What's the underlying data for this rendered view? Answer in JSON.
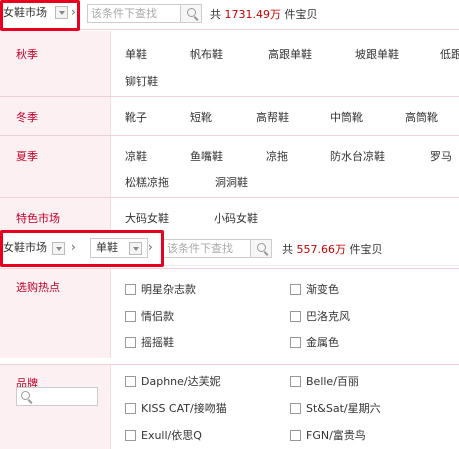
{
  "top_bar": {
    "market_label": "女鞋市场",
    "search_placeholder": "该条件下查找",
    "count_prefix": "共",
    "count_value": "1731.49万",
    "count_suffix": "件宝贝"
  },
  "categories": [
    {
      "label": "秋季",
      "items": [
        "单鞋",
        "帆布鞋",
        "高跟单鞋",
        "坡跟单鞋",
        "低跟",
        "铆钉鞋"
      ]
    },
    {
      "label": "冬季",
      "items": [
        "靴子",
        "短靴",
        "高帮鞋",
        "中筒靴",
        "高筒靴"
      ]
    },
    {
      "label": "夏季",
      "items": [
        "凉鞋",
        "鱼嘴鞋",
        "凉拖",
        "防水台凉鞋",
        "罗马",
        "松糕凉拖",
        "洞洞鞋"
      ]
    },
    {
      "label": "特色市场",
      "items": [
        "大码女鞋",
        "小码女鞋"
      ]
    }
  ],
  "sub_bar": {
    "market_label": "女鞋市场",
    "category_label": "单鞋",
    "search_placeholder": "该条件下查找",
    "count_prefix": "共",
    "count_value": "557.66万",
    "count_suffix": "件宝贝"
  },
  "attributes": [
    {
      "label": "选购热点",
      "options": [
        "明星杂志款",
        "渐变色",
        "情侣款",
        "巴洛克风",
        "摇摇鞋",
        "金属色"
      ]
    },
    {
      "label": "品牌",
      "options": [
        "Daphne/达芙妮",
        "Belle/百丽",
        "KISS CAT/接吻猫",
        "St&Sat/星期六",
        "Exull/依思Q",
        "FGN/富贵鸟"
      ]
    }
  ],
  "colors": {
    "accent": "#c2002a",
    "highlight_outline": "#e8001f",
    "label_bg": "#fdf0f2"
  }
}
